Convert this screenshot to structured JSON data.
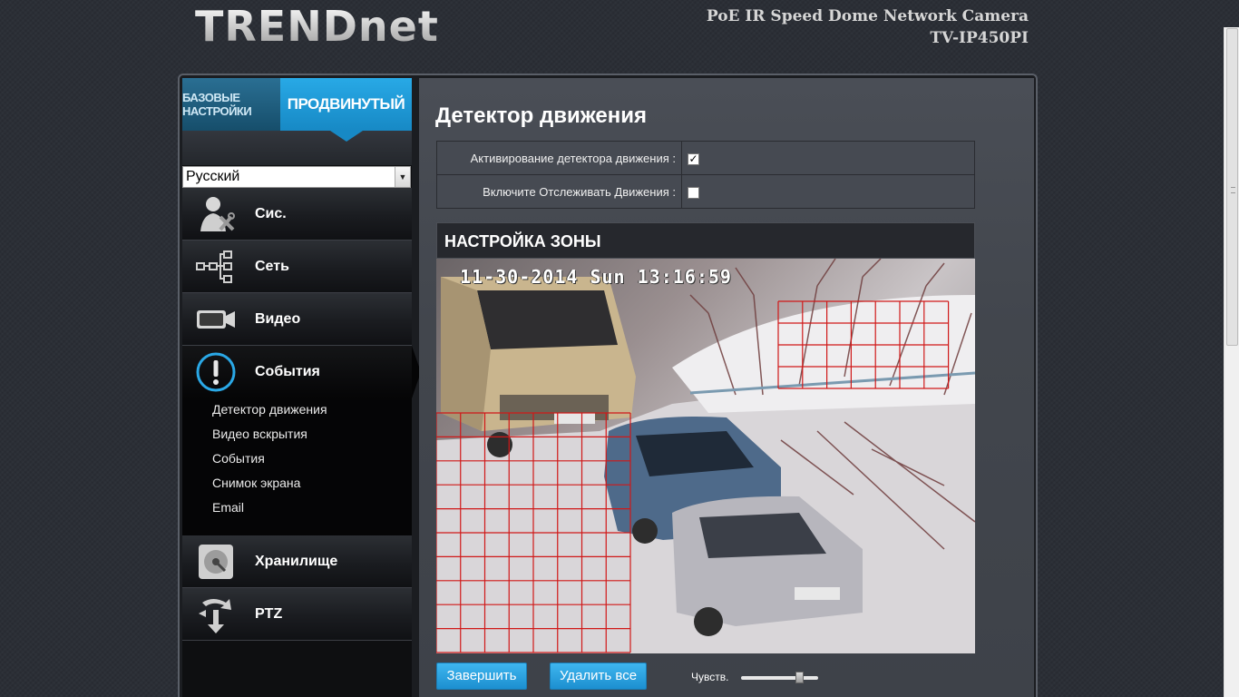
{
  "header": {
    "logo": "TRENDnet",
    "product_name": "PoE IR Speed Dome Network Camera",
    "model": "TV-IP450PI"
  },
  "sidebar": {
    "tab_basic": "БАЗОВЫЕ НАСТРОЙКИ",
    "tab_advanced": "ПРОДВИНУТЫЙ",
    "language": "Русский",
    "items": [
      {
        "label": "Сис.",
        "icon": "admin-tools-icon"
      },
      {
        "label": "Сеть",
        "icon": "network-tree-icon"
      },
      {
        "label": "Видео",
        "icon": "video-camera-icon"
      },
      {
        "label": "События",
        "icon": "exclamation-icon"
      },
      {
        "label": "Хранилище",
        "icon": "storage-disk-icon"
      },
      {
        "label": "PTZ",
        "icon": "ptz-arrows-icon"
      }
    ],
    "events_submenu": [
      "Детектор движения",
      "Видео вскрытия",
      "События",
      "Снимок экрана",
      "Email"
    ]
  },
  "main": {
    "title": "Детектор движения",
    "settings": [
      {
        "label": "Активирование детектора движения :",
        "checked": true
      },
      {
        "label": "Включите Отслеживать Движения :",
        "checked": false
      }
    ],
    "zone_title": "НАСТРОЙКА ЗОНЫ",
    "timestamp": "11-30-2014 Sun 13:16:59",
    "buttons": {
      "finish": "Завершить",
      "delete_all": "Удалить все"
    },
    "sensitivity_label": "Чувств.",
    "sensitivity_value": 0.77
  },
  "colors": {
    "accent": "#1b8fd0",
    "grid_line": "#d01818"
  }
}
